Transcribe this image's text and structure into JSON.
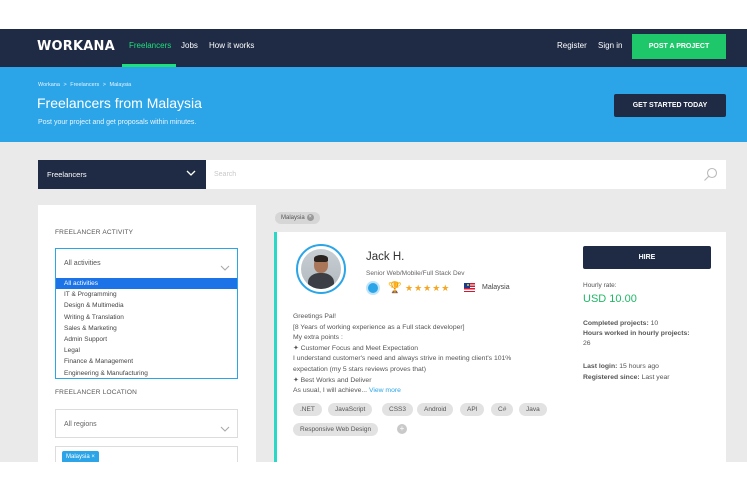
{
  "navbar": {
    "logo": "WORKANA",
    "links": [
      "Freelancers",
      "Jobs",
      "How it works"
    ],
    "register": "Register",
    "signin": "Sign in",
    "post_project": "POST A PROJECT"
  },
  "hero": {
    "breadcrumb": [
      "Workana",
      ">",
      "Freelancers",
      ">",
      "Malaysia"
    ],
    "title": "Freelancers from Malaysia",
    "subtitle": "Post your project and get proposals within minutes.",
    "cta": "GET STARTED TODAY"
  },
  "search": {
    "category": "Freelancers",
    "placeholder": "Search"
  },
  "sidebar": {
    "activity_title": "FREELANCER ACTIVITY",
    "activity_selected": "All activities",
    "activity_options": [
      "All activities",
      "IT & Programming",
      "Design & Multimedia",
      "Writing & Translation",
      "Sales & Marketing",
      "Admin Support",
      "Legal",
      "Finance & Management",
      "Engineering & Manufacturing"
    ],
    "location_title": "FREELANCER LOCATION",
    "region_selected": "All regions",
    "location_tag": "Malaysia ×"
  },
  "filter_chip": "Malaysia",
  "freelancer": {
    "name": "Jack H.",
    "role": "Senior Web/Mobile/Full Stack Dev",
    "rating_stars": 5,
    "country": "Malaysia",
    "description_lines": [
      "Greetings Pal!",
      "[8 Years of working experience as a Full stack developer]",
      "My extra points :",
      "✦ Customer Focus and Meet Expectation",
      "I understand customer's need and always strive in meeting client's 101%",
      "expectation (my 5 stars reviews proves that)",
      "✦ Best Works and Deliver",
      "As usual, I will achieve..."
    ],
    "view_more": "View more",
    "skills": [
      ".NET",
      "JavaScript",
      "CSS3",
      "Android",
      "API",
      "C#",
      "Java",
      "Responsive Web Design"
    ],
    "hire": "HIRE",
    "hourly_rate_label": "Hourly rate:",
    "hourly_rate": "USD 10.00",
    "completed_projects_label": "Completed projects:",
    "completed_projects": "10",
    "hours_worked_label": "Hours worked in hourly projects:",
    "hours_worked": "26",
    "last_login_label": "Last login:",
    "last_login": "15 hours ago",
    "registered_label": "Registered since:",
    "registered": "Last year"
  },
  "colors": {
    "navy": "#1f2b45",
    "green": "#1fc76b",
    "blue": "#2ba5e8",
    "teal": "#2ad8c6"
  }
}
